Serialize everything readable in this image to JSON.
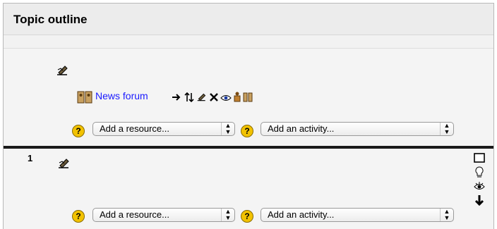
{
  "header": {
    "title": "Topic outline"
  },
  "section0": {
    "activity": {
      "label": "News forum"
    },
    "add_resource": {
      "value": "Add a resource..."
    },
    "add_activity": {
      "value": "Add an activity..."
    },
    "help_glyph": "?"
  },
  "section1": {
    "number": "1",
    "add_resource": {
      "value": "Add a resource..."
    },
    "add_activity": {
      "value": "Add an activity..."
    },
    "help_glyph": "?"
  },
  "icons": {
    "edit": "pencil-edit-icon",
    "forum": "forum-icon",
    "move_right": "move-right-icon",
    "move": "move-icon",
    "delete": "delete-icon",
    "hide": "eye-icon",
    "group_mode": "group-mode-icon",
    "assign_roles": "assign-roles-icon",
    "show_only": "show-only-topic-icon",
    "highlight": "lightbulb-icon",
    "move_down": "move-down-icon"
  },
  "colors": {
    "link": "#1a1aff",
    "help": "#f2c200"
  }
}
